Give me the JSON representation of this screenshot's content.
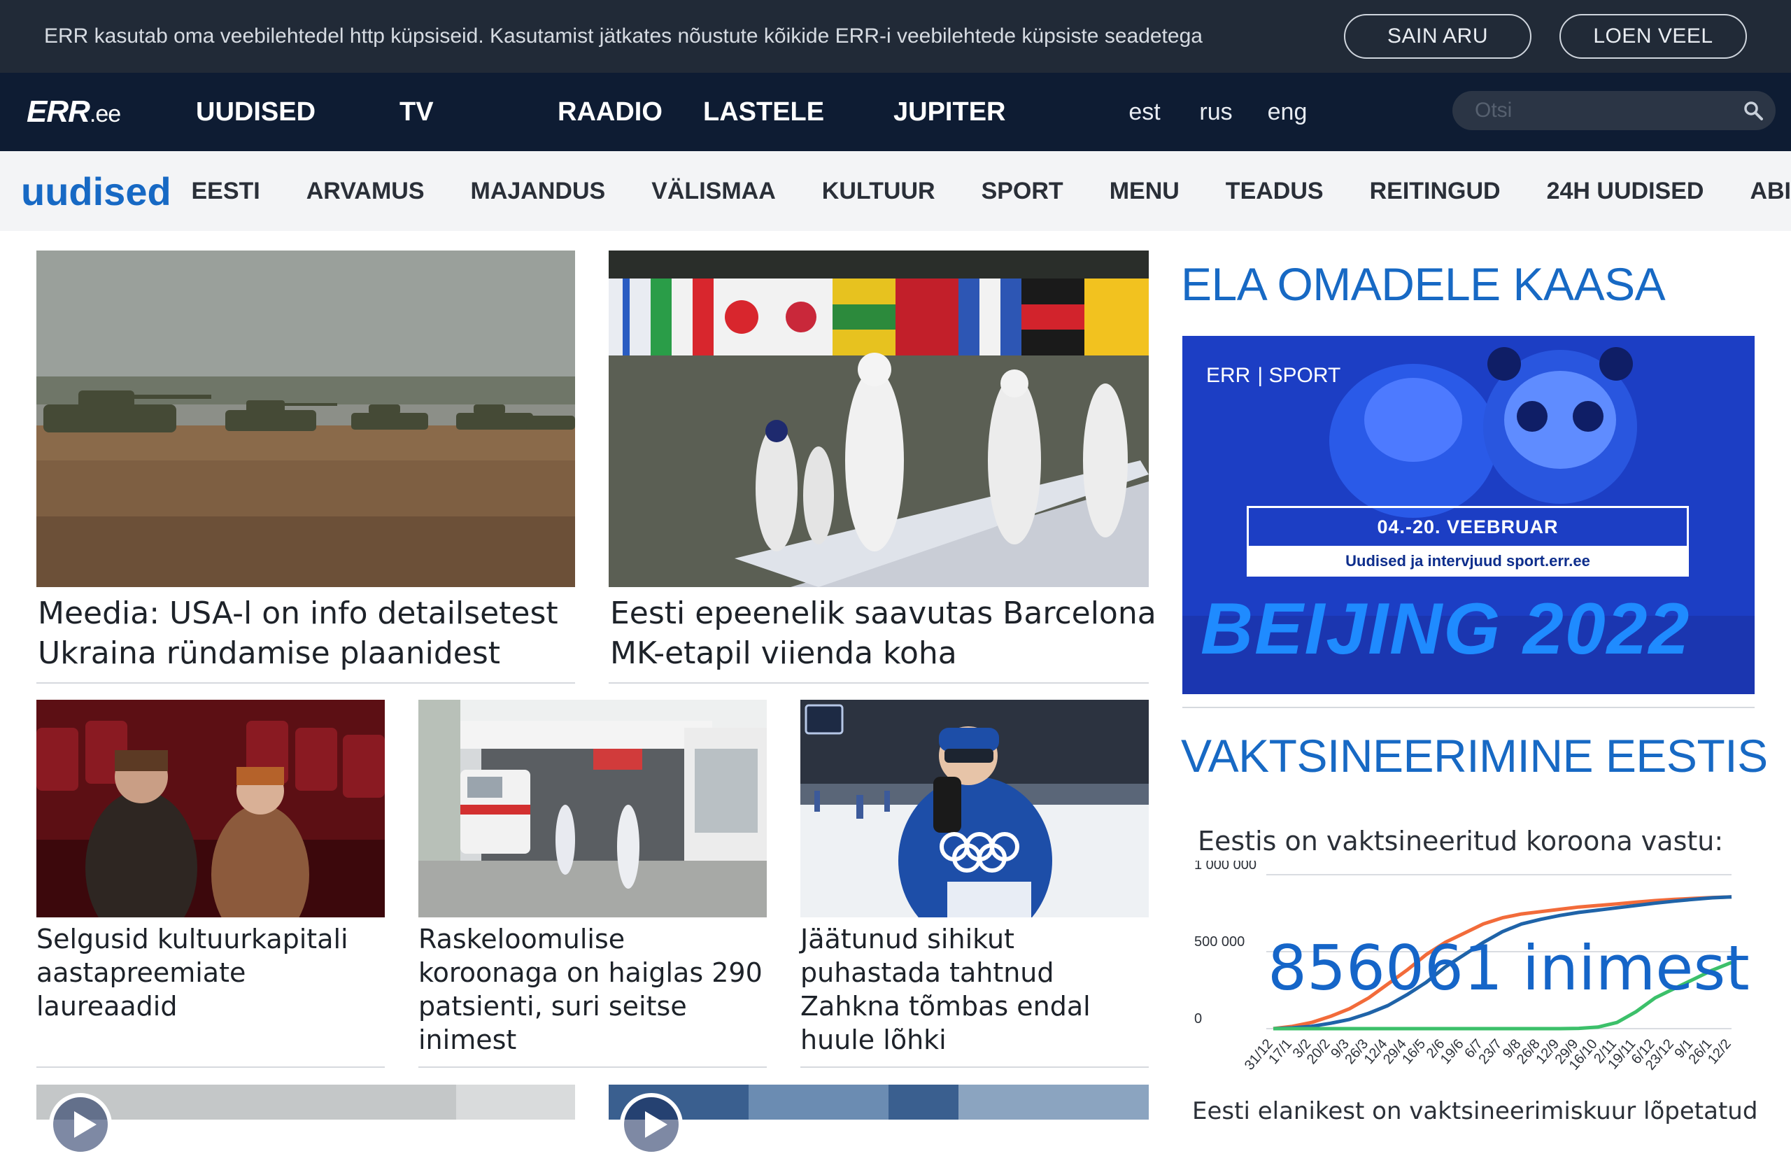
{
  "cookie": {
    "text": "ERR kasutab oma veebilehtedel http küpsiseid. Kasutamist jätkates nõustute kõikide ERR-i veebilehtede küpsiste seadetega",
    "accept_label": "SAIN ARU",
    "more_label": "LOEN VEEL"
  },
  "topnav": {
    "logo": "ERR",
    "logo_suffix": ".ee",
    "items": [
      "UUDISED",
      "TV",
      "RAADIO",
      "LASTELE",
      "JUPITER"
    ],
    "langs": [
      "est",
      "rus",
      "eng"
    ],
    "search_placeholder": "Otsi"
  },
  "subnav": {
    "section": "uudised",
    "items": [
      "EESTI",
      "ARVAMUS",
      "MAJANDUS",
      "VÄLISMAA",
      "KULTUUR",
      "SPORT",
      "MENU",
      "TEADUS",
      "REITINGUD",
      "24H UUDISED",
      "ABI"
    ]
  },
  "articles": [
    {
      "headline": "Meedia: USA-l on info detailsetest Ukraina ründamise plaanidest"
    },
    {
      "headline": "Eesti epeenelik saavutas Barcelona MK-etapil viienda koha"
    },
    {
      "headline": "Selgusid kultuurkapitali aastapreemiate laureaadid"
    },
    {
      "headline": "Raskeloomulise koroonaga on haiglas 290 patsienti, suri seitse inimest"
    },
    {
      "headline": "Jäätunud sihikut puhastada tahtnud Zahkna tõmbas endal huule lõhki"
    }
  ],
  "sidebar": {
    "title1": "ELA OMADELE KAASA",
    "banner": {
      "logo": "ERR",
      "logo_label": "| SPORT",
      "dates": "04.-20. VEEBRUAR",
      "sub": "Uudised ja intervjuud sport.err.ee",
      "big": "BEIJING 2022"
    },
    "title2": "VAKTSINEERIMINE EESTIS",
    "vac_label": "Eestis on vaktsineeritud koroona vastu:",
    "vac_big": "856061 inimest",
    "vac_foot": "Eesti elanikest on vaktsineerimiskuur lõpetatud"
  },
  "chart_data": {
    "type": "line",
    "title": "Eestis on vaktsineeritud koroona vastu:",
    "ylabels": [
      "1 000 000",
      "500 000",
      "0"
    ],
    "ylim": [
      0,
      1000000
    ],
    "x": [
      "31/12",
      "17/1",
      "3/2",
      "20/2",
      "9/3",
      "26/3",
      "12/4",
      "29/4",
      "16/5",
      "2/6",
      "19/6",
      "6/7",
      "23/7",
      "9/8",
      "26/8",
      "12/9",
      "29/9",
      "16/10",
      "2/11",
      "19/11",
      "6/12",
      "23/12",
      "9/1",
      "26/1",
      "12/2"
    ],
    "series": [
      {
        "values": [
          0,
          15000,
          40000,
          80000,
          130000,
          200000,
          290000,
          380000,
          480000,
          560000,
          620000,
          680000,
          720000,
          745000,
          760000,
          775000,
          790000,
          800000,
          810000,
          822000,
          832000,
          840000,
          846000,
          852000,
          856061
        ],
        "color": "#f26b3a"
      },
      {
        "values": [
          0,
          5000,
          15000,
          35000,
          60000,
          100000,
          150000,
          220000,
          300000,
          400000,
          480000,
          560000,
          630000,
          680000,
          710000,
          735000,
          755000,
          770000,
          785000,
          800000,
          815000,
          828000,
          840000,
          850000,
          856000
        ],
        "color": "#1f63a8"
      },
      {
        "values": [
          0,
          0,
          0,
          0,
          0,
          0,
          0,
          0,
          0,
          0,
          0,
          0,
          0,
          0,
          0,
          0,
          2000,
          10000,
          40000,
          110000,
          200000,
          260000,
          320000,
          380000,
          430000
        ],
        "color": "#3cc06a"
      }
    ]
  },
  "colors": {
    "accent": "#1769c4",
    "cookie_bg": "#212a37",
    "nav_bg": "#0e1c33"
  }
}
